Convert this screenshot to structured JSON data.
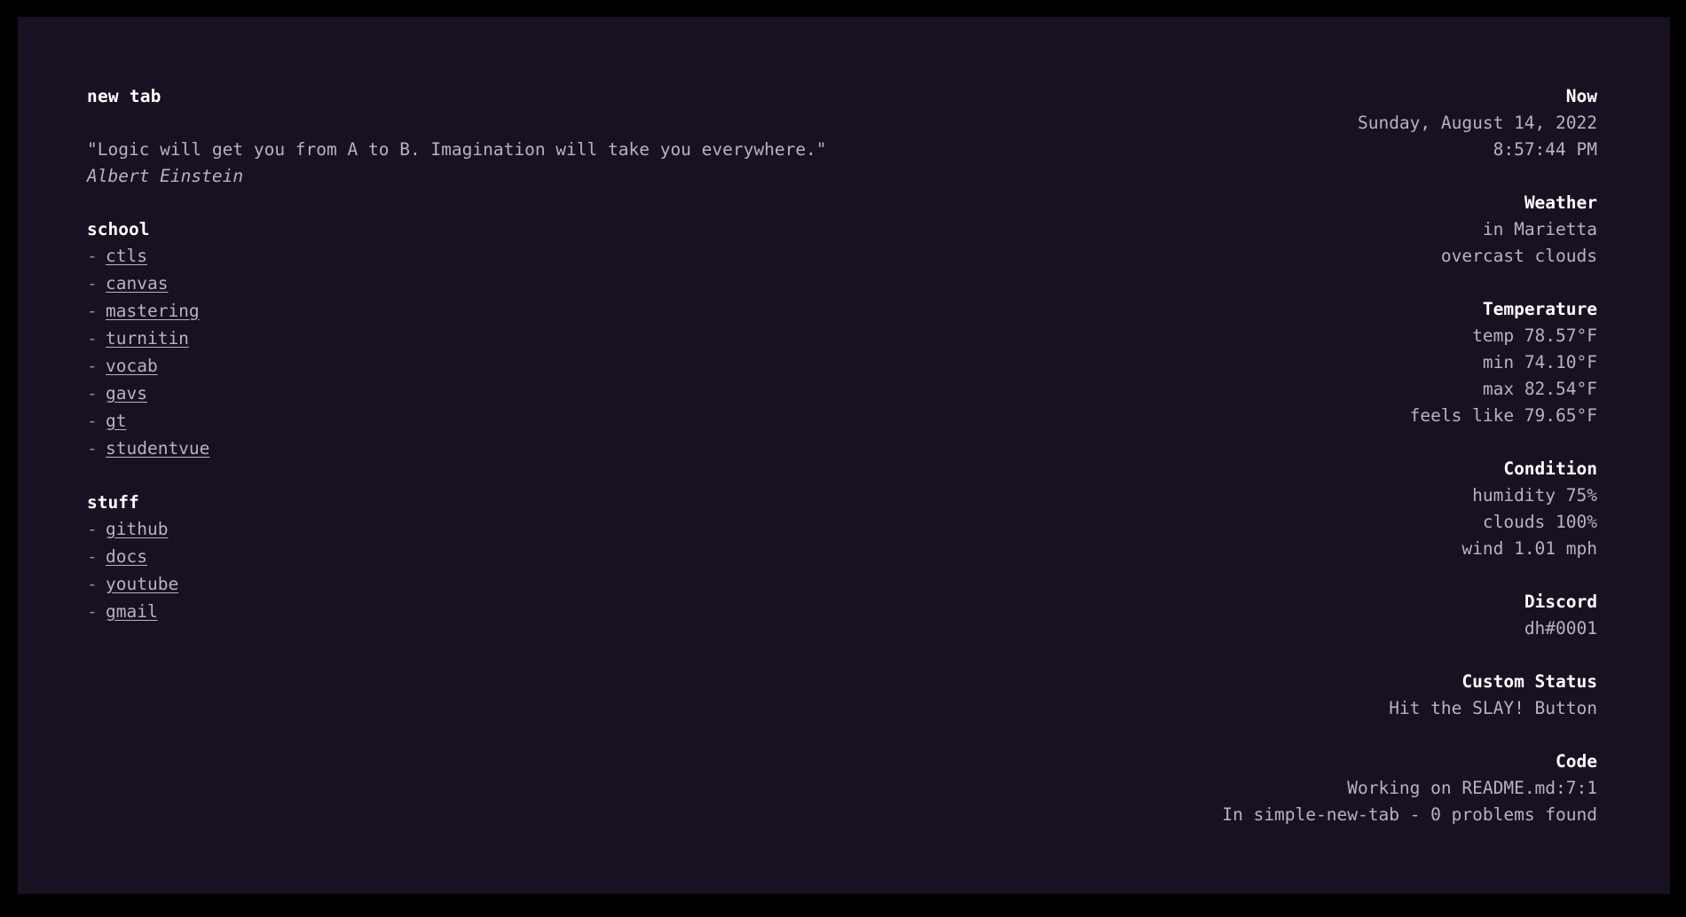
{
  "theme": {
    "outer_background": "#000000",
    "panel_background": "#191121",
    "heading_color": "#ffffff",
    "body_color": "#b6b2c4",
    "dash_color": "#8d889c"
  },
  "page": {
    "title": "new tab"
  },
  "quote": {
    "text": "\"Logic will get you from A to B. Imagination will take you everywhere.\"",
    "author": "Albert Einstein"
  },
  "link_groups": [
    {
      "title": "school",
      "bullet": "-",
      "links": [
        {
          "label": "ctls"
        },
        {
          "label": "canvas"
        },
        {
          "label": "mastering"
        },
        {
          "label": "turnitin"
        },
        {
          "label": "vocab"
        },
        {
          "label": "gavs"
        },
        {
          "label": "gt"
        },
        {
          "label": "studentvue"
        }
      ]
    },
    {
      "title": "stuff",
      "bullet": "-",
      "links": [
        {
          "label": "github"
        },
        {
          "label": "docs"
        },
        {
          "label": "youtube"
        },
        {
          "label": "gmail"
        }
      ]
    }
  ],
  "panels": {
    "now": {
      "title": "Now",
      "date": "Sunday, August 14, 2022",
      "time": "8:57:44 PM"
    },
    "weather": {
      "title": "Weather",
      "location": "in Marietta",
      "description": "overcast clouds"
    },
    "temperature": {
      "title": "Temperature",
      "temp": "temp 78.57°F",
      "min": "min 74.10°F",
      "max": "max 82.54°F",
      "feels_like": "feels like 79.65°F"
    },
    "condition": {
      "title": "Condition",
      "humidity": "humidity 75%",
      "clouds": "clouds 100%",
      "wind": "wind 1.01 mph"
    },
    "discord": {
      "title": "Discord",
      "username": "dh#0001"
    },
    "custom_status": {
      "title": "Custom Status",
      "status": "Hit the SLAY! Button"
    },
    "code": {
      "title": "Code",
      "working_on": "Working on README.md:7:1",
      "workspace": "In simple-new-tab - 0 problems found"
    }
  }
}
